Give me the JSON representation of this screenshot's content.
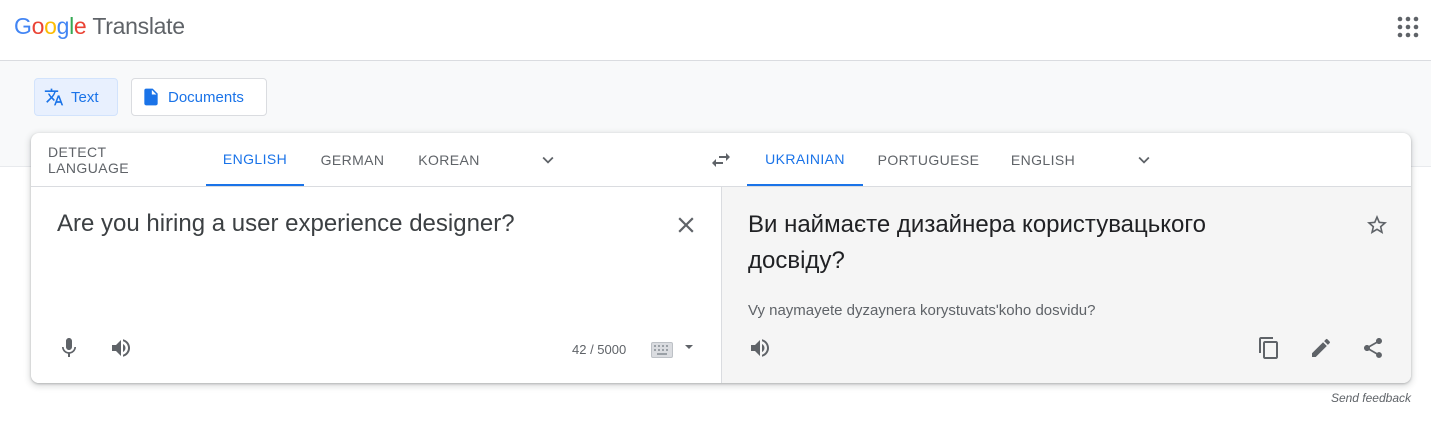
{
  "header": {
    "logo_letters": [
      "G",
      "o",
      "o",
      "g",
      "l",
      "e"
    ],
    "product": "Translate",
    "apps_icon": "grid-apps-icon"
  },
  "modes": {
    "text_label": "Text",
    "documents_label": "Documents"
  },
  "source_langs": [
    "DETECT LANGUAGE",
    "ENGLISH",
    "GERMAN",
    "KOREAN"
  ],
  "source_selected": "ENGLISH",
  "target_langs": [
    "UKRAINIAN",
    "PORTUGUESE",
    "ENGLISH"
  ],
  "target_selected": "UKRAINIAN",
  "source": {
    "text": "Are you hiring a user experience designer?",
    "char_count": "42 / 5000"
  },
  "target": {
    "text": "Ви наймаєте дизайнера користувацького досвіду?",
    "transliteration": "Vy naymayete dyzaynera korystuvatsʹkoho dosvidu?"
  },
  "footer": {
    "feedback": "Send feedback"
  },
  "colors": {
    "accent": "#1a73e8",
    "active_mode_bg": "#e8f0fe",
    "target_panel_bg": "#f5f5f5",
    "icon_gray": "#5f6368"
  }
}
